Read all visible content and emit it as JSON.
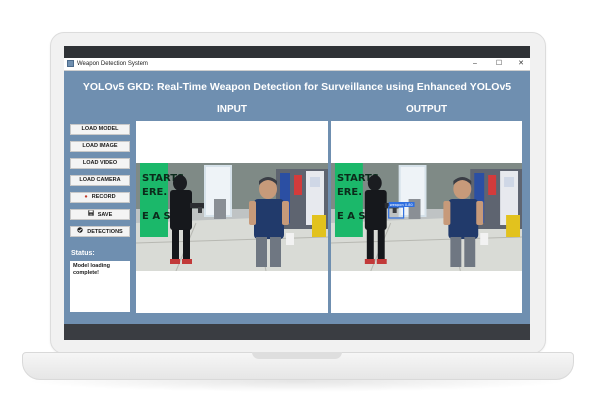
{
  "window": {
    "title": "Weapon Detection System",
    "controls": {
      "minimize": "–",
      "maximize": "☐",
      "close": "✕"
    }
  },
  "app": {
    "heading": "YOLOv5 GKD: Real-Time Weapon Detection for Surveillance using Enhanced YOLOv5",
    "input_label": "INPUT",
    "output_label": "OUTPUT"
  },
  "sidebar": {
    "buttons": [
      {
        "label": "LOAD MODEL"
      },
      {
        "label": "LOAD IMAGE"
      },
      {
        "label": "LOAD VIDEO"
      },
      {
        "label": "LOAD CAMERA"
      },
      {
        "label": "RECORD",
        "icon": "record-icon"
      },
      {
        "label": "SAVE",
        "icon": "save-icon"
      },
      {
        "label": "DETECTIONS",
        "icon": "detections-icon"
      }
    ],
    "status_label": "Status:",
    "status_text": "Model loading complete!"
  },
  "scene": {
    "window_sign_text": "STARTS HERE. EASE",
    "detection_label": "weapon 0.80",
    "detection_color": "#2f6fe0"
  },
  "colors": {
    "window_bg": "#6f8fb0",
    "button_bg": "#f4f4f4",
    "panel_bg": "#ffffff",
    "sign_green": "#1bb86a"
  }
}
